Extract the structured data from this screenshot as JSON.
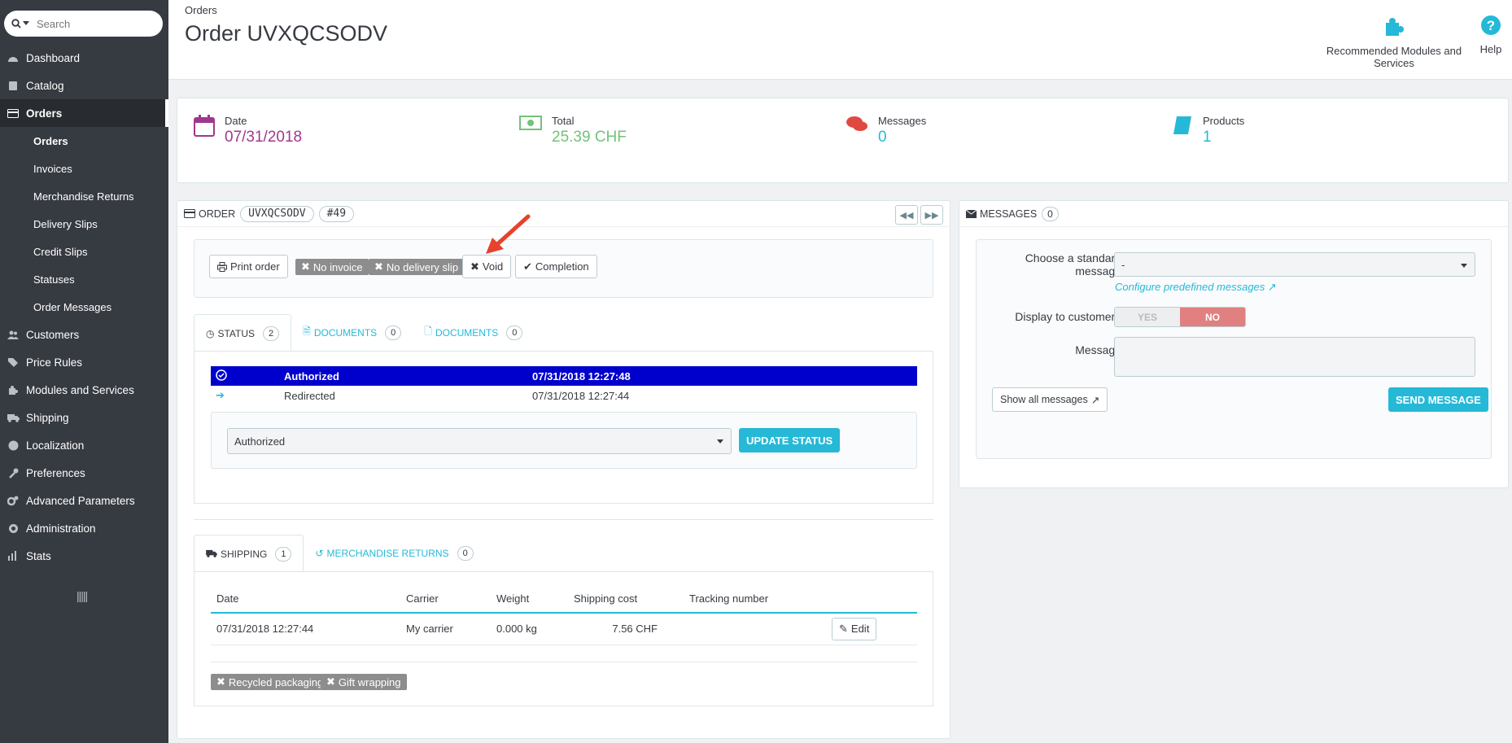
{
  "search": {
    "placeholder": "Search"
  },
  "sidebar": {
    "items": [
      {
        "label": "Dashboard"
      },
      {
        "label": "Catalog"
      },
      {
        "label": "Orders"
      },
      {
        "label": "Customers"
      },
      {
        "label": "Price Rules"
      },
      {
        "label": "Modules and Services"
      },
      {
        "label": "Shipping"
      },
      {
        "label": "Localization"
      },
      {
        "label": "Preferences"
      },
      {
        "label": "Advanced Parameters"
      },
      {
        "label": "Administration"
      },
      {
        "label": "Stats"
      }
    ],
    "orders_sub": [
      {
        "label": "Orders"
      },
      {
        "label": "Invoices"
      },
      {
        "label": "Merchandise Returns"
      },
      {
        "label": "Delivery Slips"
      },
      {
        "label": "Credit Slips"
      },
      {
        "label": "Statuses"
      },
      {
        "label": "Order Messages"
      }
    ]
  },
  "header": {
    "breadcrumb": "Orders",
    "title": "Order UVXQCSODV",
    "toolbar": {
      "recommended": "Recommended Modules and Services",
      "help": "Help"
    }
  },
  "kpi": {
    "date": {
      "label": "Date",
      "value": "07/31/2018"
    },
    "total": {
      "label": "Total",
      "value": "25.39 CHF"
    },
    "messages": {
      "label": "Messages",
      "value": "0"
    },
    "products": {
      "label": "Products",
      "value": "1"
    }
  },
  "order_panel": {
    "heading": "ORDER",
    "reference": "UVXQCSODV",
    "number": "#49",
    "actions": {
      "print": "Print order",
      "no_invoice": "No invoice",
      "no_delivery": "No delivery slip",
      "void": "Void",
      "completion": "Completion"
    },
    "tabs": [
      {
        "label": "STATUS",
        "count": "2"
      },
      {
        "label": "DOCUMENTS",
        "count": "0"
      },
      {
        "label": "DOCUMENTS",
        "count": "0"
      }
    ],
    "history": [
      {
        "status": "Authorized",
        "date": "07/31/2018 12:27:48"
      },
      {
        "status": "Redirected",
        "date": "07/31/2018 12:27:44"
      }
    ],
    "status_select": "Authorized",
    "update_button": "UPDATE STATUS",
    "shipping_tabs": [
      {
        "label": "SHIPPING",
        "count": "1"
      },
      {
        "label": "MERCHANDISE RETURNS",
        "count": "0"
      }
    ],
    "shipping_table": {
      "headers": [
        "Date",
        "Carrier",
        "Weight",
        "Shipping cost",
        "Tracking number"
      ],
      "rows": [
        {
          "date": "07/31/2018 12:27:44",
          "carrier": "My carrier",
          "weight": "0.000 kg",
          "cost": "7.56 CHF",
          "tracking": ""
        }
      ],
      "edit_label": "Edit"
    },
    "flags": {
      "recycled": "Recycled packaging",
      "gift": "Gift wrapping"
    }
  },
  "messages_panel": {
    "heading": "MESSAGES",
    "count": "0",
    "choose_label_1": "Choose a standard",
    "choose_label_2": "message",
    "choose_value": "-",
    "configure_link": "Configure predefined messages",
    "display_label": "Display to customer?",
    "yes": "YES",
    "no": "NO",
    "message_label": "Message",
    "show_all": "Show all messages",
    "send": "SEND MESSAGE"
  },
  "colors": {
    "accent": "#25b9d7",
    "date_purple": "#a0378f",
    "total_green": "#72c279",
    "messages_red": "#e0493f",
    "highlight_row": "#0000cc",
    "no_toggle": "#e08080"
  }
}
